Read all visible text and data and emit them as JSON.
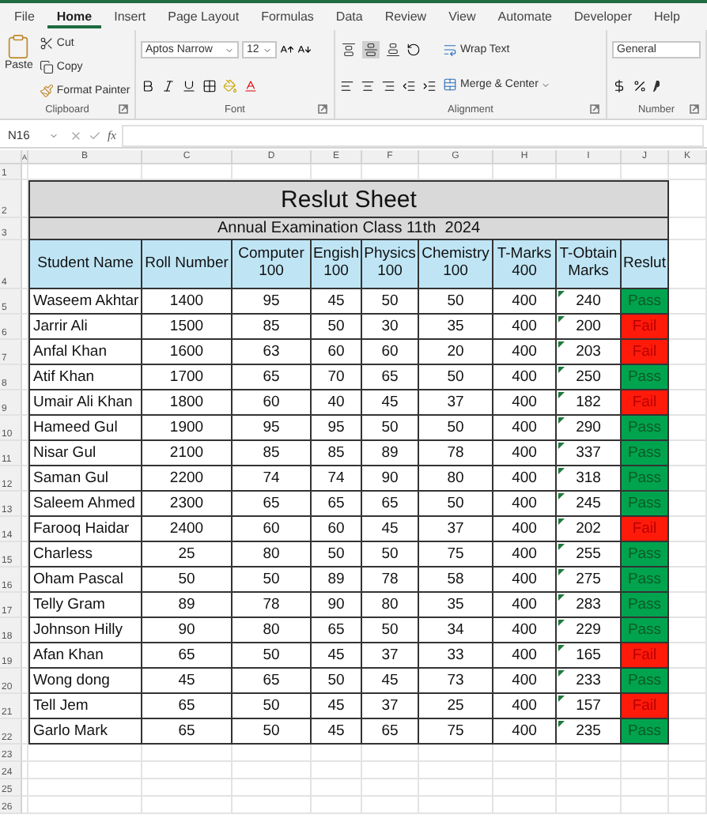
{
  "ribbon_tabs": [
    {
      "label": "File",
      "selected": false
    },
    {
      "label": "Home",
      "selected": true
    },
    {
      "label": "Insert",
      "selected": false
    },
    {
      "label": "Page Layout",
      "selected": false
    },
    {
      "label": "Formulas",
      "selected": false
    },
    {
      "label": "Data",
      "selected": false
    },
    {
      "label": "Review",
      "selected": false
    },
    {
      "label": "View",
      "selected": false
    },
    {
      "label": "Automate",
      "selected": false
    },
    {
      "label": "Developer",
      "selected": false
    },
    {
      "label": "Help",
      "selected": false
    }
  ],
  "clipboard": {
    "paste": "Paste",
    "cut": "Cut",
    "copy": "Copy",
    "format_painter": "Format Painter",
    "label": "Clipboard"
  },
  "font": {
    "name": "Aptos Narrow",
    "size": "12",
    "label": "Font"
  },
  "alignment": {
    "vertical_align_buttons": [
      {
        "selected": false
      },
      {
        "selected": true
      },
      {
        "selected": false
      }
    ],
    "wrap_text": "Wrap Text",
    "merge_center": "Merge & Center",
    "label": "Alignment"
  },
  "number": {
    "format": "General",
    "label": "Number"
  },
  "formula_bar": {
    "name_box": "N16",
    "function_label": "fx"
  },
  "sheet": {
    "column_letters": [
      "A",
      "B",
      "C",
      "D",
      "E",
      "F",
      "G",
      "H",
      "I",
      "J",
      "K"
    ],
    "row_numbers": [
      "1",
      "2",
      "3",
      "4",
      "5",
      "6",
      "7",
      "8",
      "9",
      "10",
      "11",
      "12",
      "13",
      "14",
      "15",
      "16",
      "17",
      "18",
      "19",
      "20",
      "21",
      "22",
      "23",
      "24",
      "25",
      "26"
    ],
    "title": "Reslut Sheet",
    "subtitle": "Annual Examination Class 11th  2024",
    "headers": [
      [
        "Student Name"
      ],
      [
        "Roll Number"
      ],
      [
        "Computer",
        "100"
      ],
      [
        "Engish",
        "100"
      ],
      [
        "Physics",
        "100"
      ],
      [
        "Chemistry",
        "100"
      ],
      [
        "T-Marks",
        "400"
      ],
      [
        "T-Obtain",
        "Marks"
      ],
      [
        "Reslut"
      ]
    ],
    "rows": [
      {
        "cells": [
          "Waseem Akhtar",
          "1400",
          "95",
          "45",
          "50",
          "50",
          "400",
          "240"
        ],
        "result": "Pass",
        "kind": "pass",
        "flagged": true
      },
      {
        "cells": [
          "Jarrir Ali",
          "1500",
          "85",
          "50",
          "30",
          "35",
          "400",
          "200"
        ],
        "result": "Fail",
        "kind": "fail",
        "flagged": true
      },
      {
        "cells": [
          "Anfal Khan",
          "1600",
          "63",
          "60",
          "60",
          "20",
          "400",
          "203"
        ],
        "result": "Fail",
        "kind": "fail",
        "flagged": true
      },
      {
        "cells": [
          "Atif Khan",
          "1700",
          "65",
          "70",
          "65",
          "50",
          "400",
          "250"
        ],
        "result": "Pass",
        "kind": "pass",
        "flagged": true
      },
      {
        "cells": [
          "Umair Ali Khan",
          "1800",
          "60",
          "40",
          "45",
          "37",
          "400",
          "182"
        ],
        "result": "Fail",
        "kind": "fail",
        "flagged": true
      },
      {
        "cells": [
          "Hameed Gul",
          "1900",
          "95",
          "95",
          "50",
          "50",
          "400",
          "290"
        ],
        "result": "Pass",
        "kind": "pass",
        "flagged": true
      },
      {
        "cells": [
          "Nisar Gul",
          "2100",
          "85",
          "85",
          "89",
          "78",
          "400",
          "337"
        ],
        "result": "Pass",
        "kind": "pass",
        "flagged": true
      },
      {
        "cells": [
          "Saman Gul",
          "2200",
          "74",
          "74",
          "90",
          "80",
          "400",
          "318"
        ],
        "result": "Pass",
        "kind": "pass",
        "flagged": true
      },
      {
        "cells": [
          "Saleem Ahmed",
          "2300",
          "65",
          "65",
          "65",
          "50",
          "400",
          "245"
        ],
        "result": "Pass",
        "kind": "pass",
        "flagged": true
      },
      {
        "cells": [
          "Farooq Haidar",
          "2400",
          "60",
          "60",
          "45",
          "37",
          "400",
          "202"
        ],
        "result": "Fail",
        "kind": "fail",
        "flagged": true
      },
      {
        "cells": [
          "Charless",
          "25",
          "80",
          "50",
          "50",
          "75",
          "400",
          "255"
        ],
        "result": "Pass",
        "kind": "pass",
        "flagged": true
      },
      {
        "cells": [
          "Oham Pascal",
          "50",
          "50",
          "89",
          "78",
          "58",
          "400",
          "275"
        ],
        "result": "Pass",
        "kind": "pass",
        "flagged": true
      },
      {
        "cells": [
          "Telly Gram",
          "89",
          "78",
          "90",
          "80",
          "35",
          "400",
          "283"
        ],
        "result": "Pass",
        "kind": "pass",
        "flagged": true
      },
      {
        "cells": [
          "Johnson Hilly",
          "90",
          "80",
          "65",
          "50",
          "34",
          "400",
          "229"
        ],
        "result": "Pass",
        "kind": "pass",
        "flagged": true
      },
      {
        "cells": [
          "Afan Khan",
          "65",
          "50",
          "45",
          "37",
          "33",
          "400",
          "165"
        ],
        "result": "Fail",
        "kind": "fail",
        "flagged": true
      },
      {
        "cells": [
          "Wong dong",
          "45",
          "65",
          "50",
          "45",
          "73",
          "400",
          "233"
        ],
        "result": "Pass",
        "kind": "pass",
        "flagged": true
      },
      {
        "cells": [
          "Tell Jem",
          "65",
          "50",
          "45",
          "37",
          "25",
          "400",
          "157"
        ],
        "result": "Fail",
        "kind": "fail",
        "flagged": true
      },
      {
        "cells": [
          "Garlo Mark",
          "65",
          "50",
          "45",
          "65",
          "75",
          "400",
          "235"
        ],
        "result": "Pass",
        "kind": "pass",
        "flagged": true
      }
    ]
  }
}
